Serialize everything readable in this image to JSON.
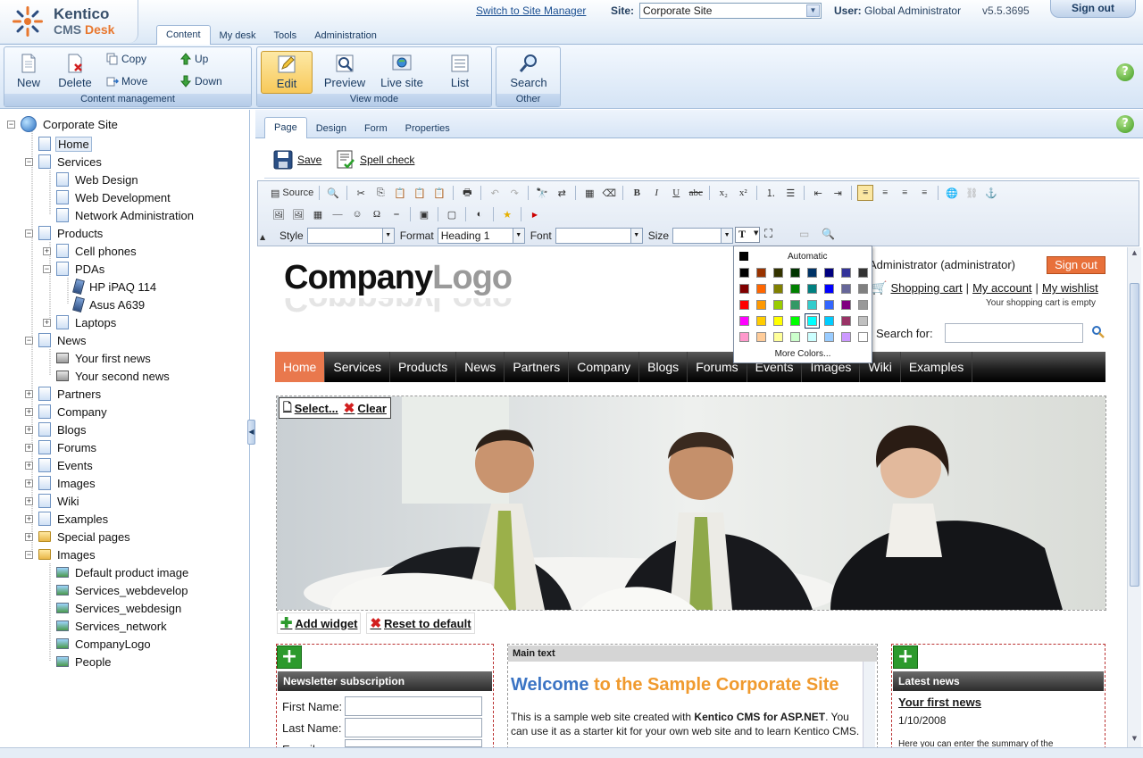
{
  "header": {
    "logo_line1": "Kentico",
    "logo_line2a": "CMS ",
    "logo_line2b": "Desk",
    "tabs": [
      "Content",
      "My desk",
      "Tools",
      "Administration"
    ],
    "switch_link": "Switch to Site Manager",
    "site_label": "Site:",
    "site_value": "Corporate Site",
    "user_label": "User:",
    "user_value": "Global Administrator",
    "version": "v5.5.3695",
    "signout": "Sign out"
  },
  "ribbon": {
    "content_management": {
      "caption": "Content management",
      "new": "New",
      "delete": "Delete",
      "copy": "Copy",
      "move": "Move",
      "up": "Up",
      "down": "Down"
    },
    "view_mode": {
      "caption": "View mode",
      "edit": "Edit",
      "preview": "Preview",
      "live_site": "Live site",
      "list": "List"
    },
    "other": {
      "caption": "Other",
      "search": "Search"
    },
    "help": "?"
  },
  "tree": {
    "root": "Corporate Site",
    "items": [
      {
        "label": "Home",
        "icon": "page"
      },
      {
        "label": "Services",
        "icon": "page"
      },
      {
        "label": "Web Design",
        "icon": "page"
      },
      {
        "label": "Web Development",
        "icon": "page"
      },
      {
        "label": "Network Administration",
        "icon": "page"
      },
      {
        "label": "Products",
        "icon": "page"
      },
      {
        "label": "Cell phones",
        "icon": "page"
      },
      {
        "label": "PDAs",
        "icon": "page"
      },
      {
        "label": "HP iPAQ 114",
        "icon": "phone"
      },
      {
        "label": "Asus A639",
        "icon": "phone"
      },
      {
        "label": "Laptops",
        "icon": "page"
      },
      {
        "label": "News",
        "icon": "page"
      },
      {
        "label": "Your first news",
        "icon": "news"
      },
      {
        "label": "Your second news",
        "icon": "news"
      },
      {
        "label": "Partners",
        "icon": "page"
      },
      {
        "label": "Company",
        "icon": "page"
      },
      {
        "label": "Blogs",
        "icon": "page"
      },
      {
        "label": "Forums",
        "icon": "page"
      },
      {
        "label": "Events",
        "icon": "page"
      },
      {
        "label": "Images",
        "icon": "page"
      },
      {
        "label": "Wiki",
        "icon": "page"
      },
      {
        "label": "Examples",
        "icon": "page"
      },
      {
        "label": "Special pages",
        "icon": "folder"
      },
      {
        "label": "Images",
        "icon": "folder"
      },
      {
        "label": "Default product image",
        "icon": "img"
      },
      {
        "label": "Services_webdevelop",
        "icon": "img"
      },
      {
        "label": "Services_webdesign",
        "icon": "img"
      },
      {
        "label": "Services_network",
        "icon": "img"
      },
      {
        "label": "CompanyLogo",
        "icon": "img"
      },
      {
        "label": "People",
        "icon": "img"
      }
    ]
  },
  "subtabs": [
    "Page",
    "Design",
    "Form",
    "Properties"
  ],
  "actions": {
    "save": "Save",
    "spellcheck": "Spell check"
  },
  "editor": {
    "source": "Source",
    "style_label": "Style",
    "style_value": "",
    "format_label": "Format",
    "format_value": "Heading 1",
    "font_label": "Font",
    "font_value": "",
    "size_label": "Size",
    "size_value": ""
  },
  "picker": {
    "automatic": "Automatic",
    "more": "More Colors...",
    "colors": [
      "#000000",
      "#993300",
      "#333300",
      "#003300",
      "#003366",
      "#000080",
      "#333399",
      "#333333",
      "#800000",
      "#FF6600",
      "#808000",
      "#008000",
      "#008080",
      "#0000FF",
      "#666699",
      "#808080",
      "#FF0000",
      "#FF9900",
      "#99CC00",
      "#339966",
      "#33CCCC",
      "#3366FF",
      "#800080",
      "#999999",
      "#FF00FF",
      "#FFCC00",
      "#FFFF00",
      "#00FF00",
      "#00FFFF",
      "#00CCFF",
      "#993366",
      "#C0C0C0",
      "#FF99CC",
      "#FFCC99",
      "#FFFF99",
      "#CCFFCC",
      "#CCFFFF",
      "#99CCFF",
      "#CC99FF",
      "#FFFFFF"
    ],
    "selected_index": 28
  },
  "site": {
    "logo_a": "Company",
    "logo_b": "Logo",
    "greeting": "al Administrator (administrator)",
    "signout": "Sign out",
    "shopping_cart": "Shopping cart",
    "sep1": "|",
    "my_account": "My account",
    "sep2": "|",
    "my_wishlist": "My wishlist",
    "cart_empty": "Your shopping cart is empty",
    "search_label": "Search for:",
    "nav": [
      "Home",
      "Services",
      "Products",
      "News",
      "Partners",
      "Company",
      "Blogs",
      "Forums",
      "Events",
      "Images",
      "Wiki",
      "Examples"
    ],
    "select": "Select...",
    "clear": "Clear",
    "add_widget": "Add widget",
    "reset_default": "Reset to default",
    "newsletter_head": "Newsletter subscription",
    "first_name": "First Name:",
    "last_name": "Last Name:",
    "email": "E-mail:",
    "main_text_head": "Main text",
    "welcome_a": "Welcome",
    "welcome_b": " to the Sample Corporate Site",
    "intro_a": "This is a sample web site created with ",
    "intro_b": "Kentico CMS for ASP.NET",
    "intro_c": ". You can use it as a starter kit for your own web site and to learn Kentico CMS.",
    "latest_news_head": "Latest news",
    "news_title": "Your first news",
    "news_date": "1/10/2008",
    "news_summary": "Here you can enter the summary of the"
  }
}
